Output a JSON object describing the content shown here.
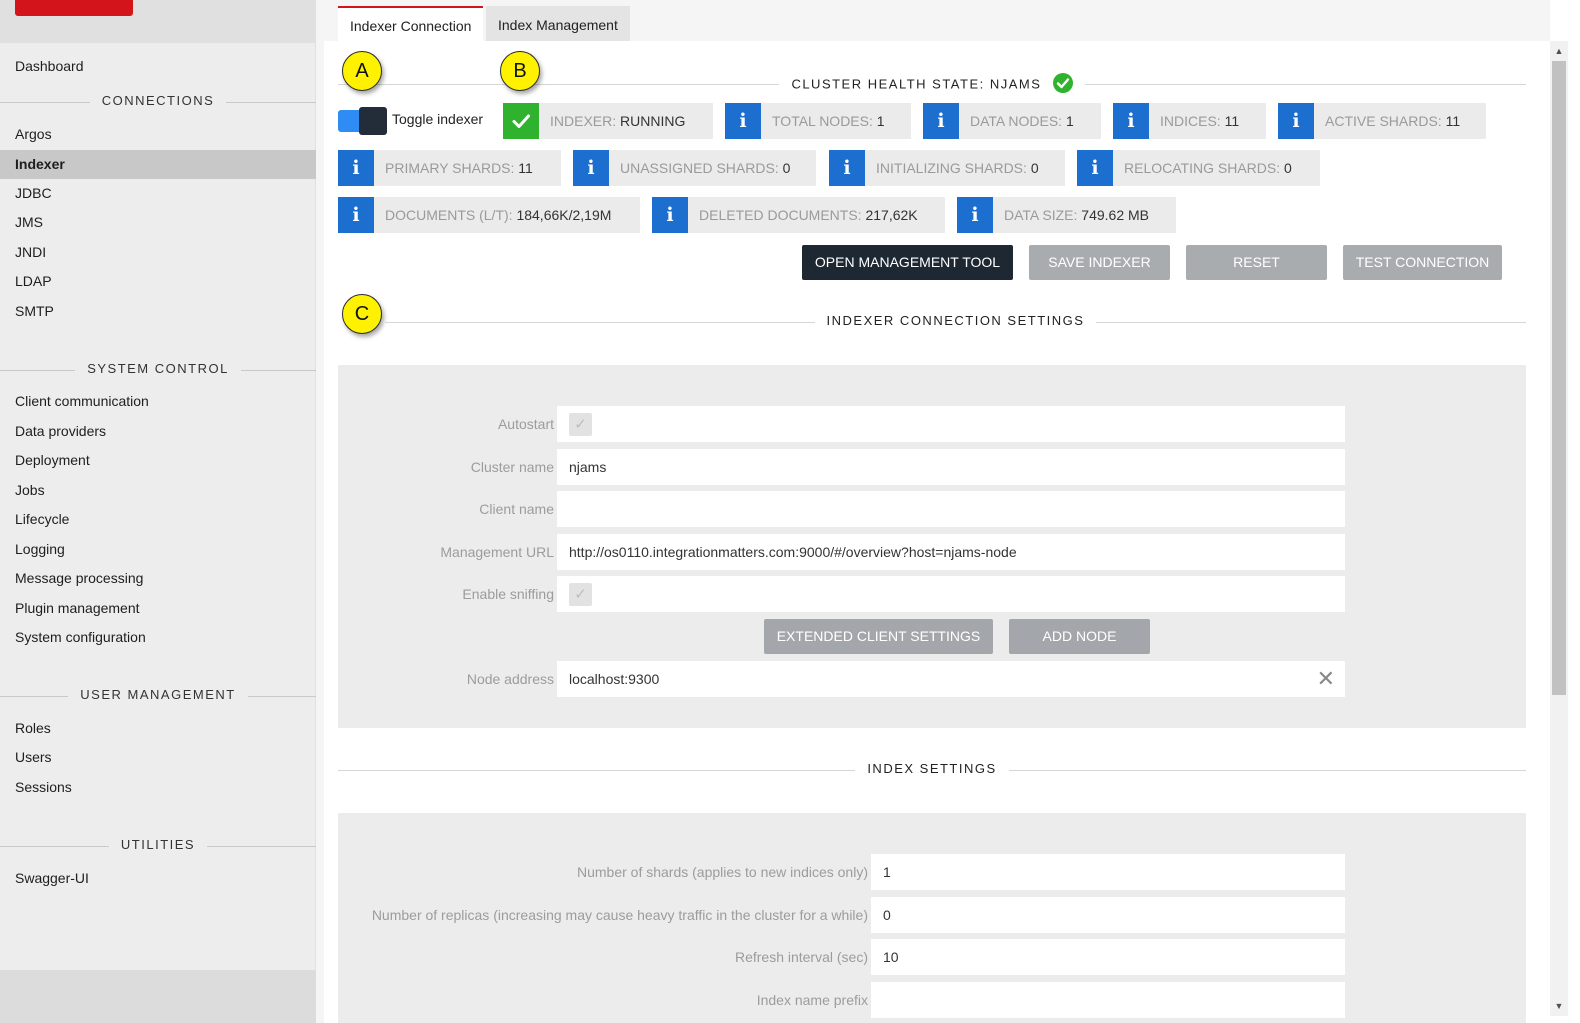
{
  "sidebar": {
    "dashboard": "Dashboard",
    "connections_header": "CONNECTIONS",
    "connections": [
      "Argos",
      "Indexer",
      "JDBC",
      "JMS",
      "JNDI",
      "LDAP",
      "SMTP"
    ],
    "system_control_header": "SYSTEM CONTROL",
    "system_control": [
      "Client communication",
      "Data providers",
      "Deployment",
      "Jobs",
      "Lifecycle",
      "Logging",
      "Message processing",
      "Plugin management",
      "System configuration"
    ],
    "user_management_header": "USER MANAGEMENT",
    "user_management": [
      "Roles",
      "Users",
      "Sessions"
    ],
    "utilities_header": "UTILITIES",
    "utilities": [
      "Swagger-UI"
    ]
  },
  "tabs": [
    "Indexer Connection",
    "Index Management"
  ],
  "markers": {
    "a": "A",
    "b": "B",
    "c": "C"
  },
  "cluster": {
    "health_title": "CLUSTER HEALTH STATE: NJAMS",
    "toggle_label": "Toggle indexer",
    "stats": [
      {
        "label": "INDEXER:",
        "value": "RUNNING",
        "icon": "check-icon"
      },
      {
        "label": "TOTAL NODES:",
        "value": "1",
        "icon": "info-icon"
      },
      {
        "label": "DATA NODES:",
        "value": "1",
        "icon": "info-icon"
      },
      {
        "label": "INDICES:",
        "value": "11",
        "icon": "info-icon"
      },
      {
        "label": "ACTIVE SHARDS:",
        "value": "11",
        "icon": "info-icon"
      },
      {
        "label": "PRIMARY SHARDS:",
        "value": "11",
        "icon": "info-icon"
      },
      {
        "label": "UNASSIGNED SHARDS:",
        "value": "0",
        "icon": "info-icon"
      },
      {
        "label": "INITIALIZING SHARDS:",
        "value": "0",
        "icon": "info-icon"
      },
      {
        "label": "RELOCATING SHARDS:",
        "value": "0",
        "icon": "info-icon"
      },
      {
        "label": "DOCUMENTS (L/T):",
        "value": "184,66K/2,19M",
        "icon": "info-icon"
      },
      {
        "label": "DELETED DOCUMENTS:",
        "value": "217,62K",
        "icon": "info-icon"
      },
      {
        "label": "DATA SIZE:",
        "value": "749.62 MB",
        "icon": "info-icon"
      }
    ]
  },
  "buttons": {
    "open_management": "OPEN MANAGEMENT TOOL",
    "save_indexer": "SAVE INDEXER",
    "reset": "RESET",
    "test_connection": "TEST CONNECTION",
    "extended_client": "EXTENDED CLIENT SETTINGS",
    "add_node": "ADD NODE"
  },
  "connection_settings": {
    "title": "INDEXER CONNECTION SETTINGS",
    "autostart_label": "Autostart",
    "cluster_name_label": "Cluster name",
    "cluster_name": "njams",
    "client_name_label": "Client name",
    "client_name": "",
    "management_url_label": "Management URL",
    "management_url": "http://os0110.integrationmatters.com:9000/#/overview?host=njams-node",
    "enable_sniffing_label": "Enable sniffing",
    "node_address_label": "Node address",
    "node_address": "localhost:9300"
  },
  "index_settings": {
    "title": "INDEX SETTINGS",
    "shards_label": "Number of shards (applies to new indices only)",
    "shards": "1",
    "replicas_label": "Number of replicas (increasing may cause heavy traffic in the cluster for a while)",
    "replicas": "0",
    "refresh_label": "Refresh interval (sec)",
    "refresh": "10",
    "prefix_label": "Index name prefix",
    "prefix": ""
  },
  "colors": {
    "brand": "#d3141b",
    "info": "#1d6fcf",
    "ok": "#2fb32f",
    "dark_button": "#1e2833"
  }
}
